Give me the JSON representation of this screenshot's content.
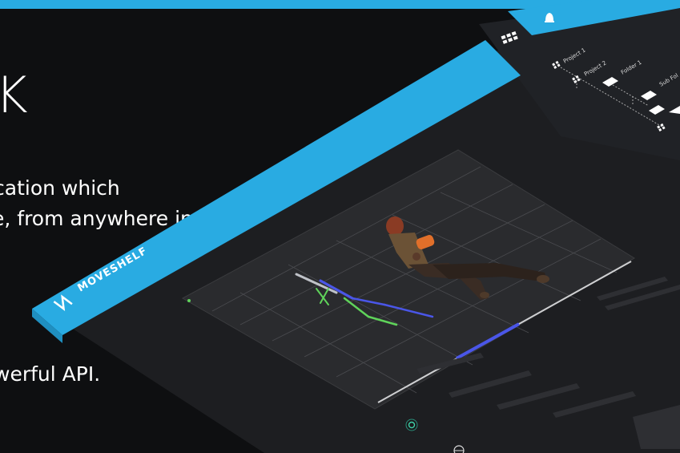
{
  "hero": {
    "title_fragment": "K",
    "line1": "cation which",
    "line2": "e, from anywhere in the world.",
    "line3": "werful API."
  },
  "app": {
    "brand": "MOVESHELF",
    "tree": [
      {
        "label": "Project 1"
      },
      {
        "label": "Project 2"
      },
      {
        "label": "Folder 1"
      },
      {
        "label": "Sub Fol"
      }
    ]
  },
  "colors": {
    "accent": "#29abe2",
    "background": "#0e0f11",
    "panel": "#1d1e21"
  }
}
